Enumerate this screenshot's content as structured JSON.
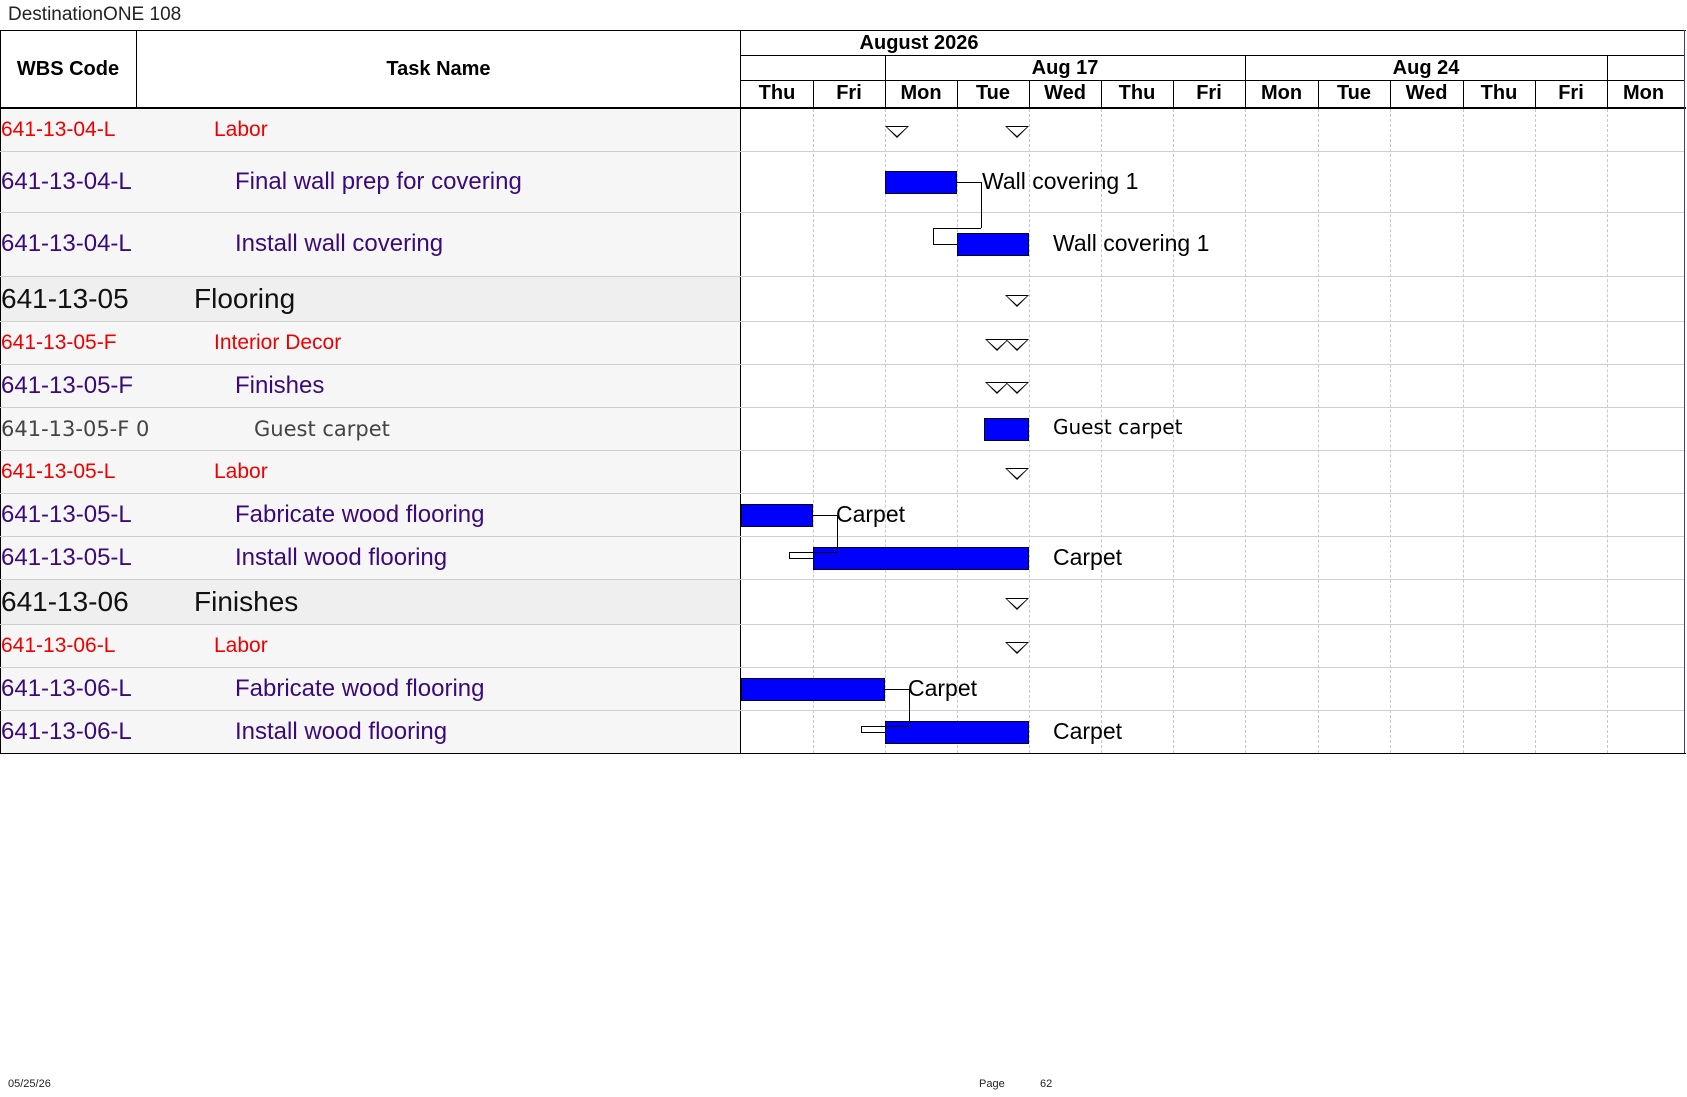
{
  "title": "DestinationONE 108",
  "columns": {
    "wbs": "WBS Code",
    "task": "Task Name"
  },
  "timescale": {
    "month": "August 2026",
    "weeks": [
      "Aug 17",
      "Aug 24"
    ],
    "days": [
      "Thu",
      "Fri",
      "Mon",
      "Tue",
      "Wed",
      "Thu",
      "Fri",
      "Mon",
      "Tue",
      "Wed",
      "Thu",
      "Fri",
      "Mon"
    ]
  },
  "rows": [
    {
      "wbs": "641-13-04-L",
      "name": "Labor",
      "level": 2
    },
    {
      "wbs": "641-13-04-L",
      "name": "Final wall prep for covering",
      "level": 3,
      "bar_label": "Wall covering 1"
    },
    {
      "wbs": "641-13-04-L",
      "name": "Install wall covering",
      "level": 3,
      "bar_label": "Wall covering 1"
    },
    {
      "wbs": "641-13-05",
      "name": "Flooring",
      "level": 1
    },
    {
      "wbs": "641-13-05-F",
      "name": "Interior Decor",
      "level": 2
    },
    {
      "wbs": "641-13-05-F",
      "name": "Finishes",
      "level": 3
    },
    {
      "wbs": "641-13-05-F 0",
      "name": "Guest carpet",
      "level": 4,
      "bar_label": "Guest carpet"
    },
    {
      "wbs": "641-13-05-L",
      "name": "Labor",
      "level": 2
    },
    {
      "wbs": "641-13-05-L",
      "name": "Fabricate wood flooring",
      "level": 3,
      "bar_label": "Carpet"
    },
    {
      "wbs": "641-13-05-L",
      "name": "Install wood flooring",
      "level": 3,
      "bar_label": "Carpet"
    },
    {
      "wbs": "641-13-06",
      "name": "Finishes",
      "level": 1
    },
    {
      "wbs": "641-13-06-L",
      "name": "Labor",
      "level": 2
    },
    {
      "wbs": "641-13-06-L",
      "name": "Fabricate wood flooring",
      "level": 3,
      "bar_label": "Carpet"
    },
    {
      "wbs": "641-13-06-L",
      "name": "Install wood flooring",
      "level": 3,
      "bar_label": "Carpet"
    }
  ],
  "footer": {
    "date": "05/25/26",
    "page_label": "Page",
    "page_number": "62"
  },
  "colors": {
    "bar": "#0000ff",
    "level1": "#111111",
    "level2": "#ee0000",
    "level3": "#3a0a7a",
    "level4": "#444444"
  }
}
